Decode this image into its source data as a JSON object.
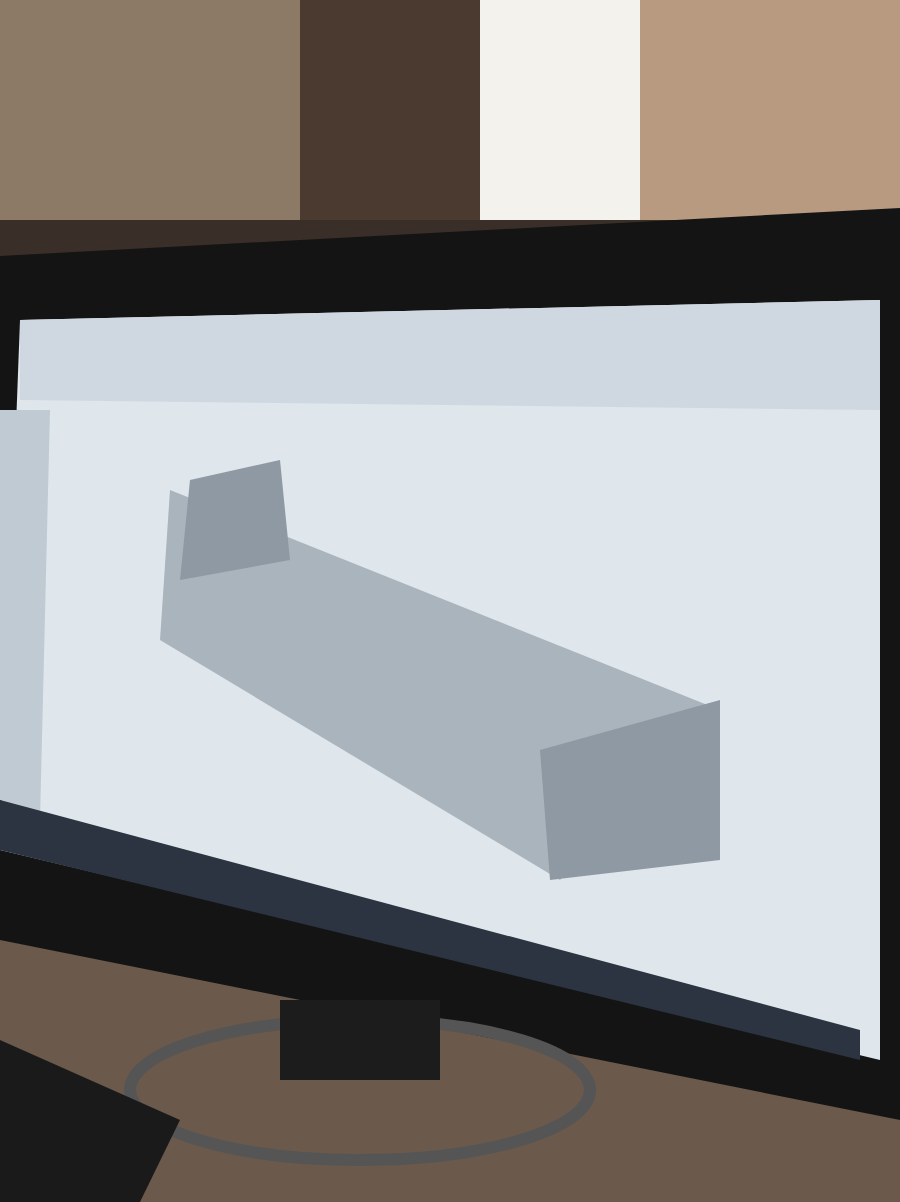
{
  "photo": {
    "kind": "monitor-scene"
  }
}
